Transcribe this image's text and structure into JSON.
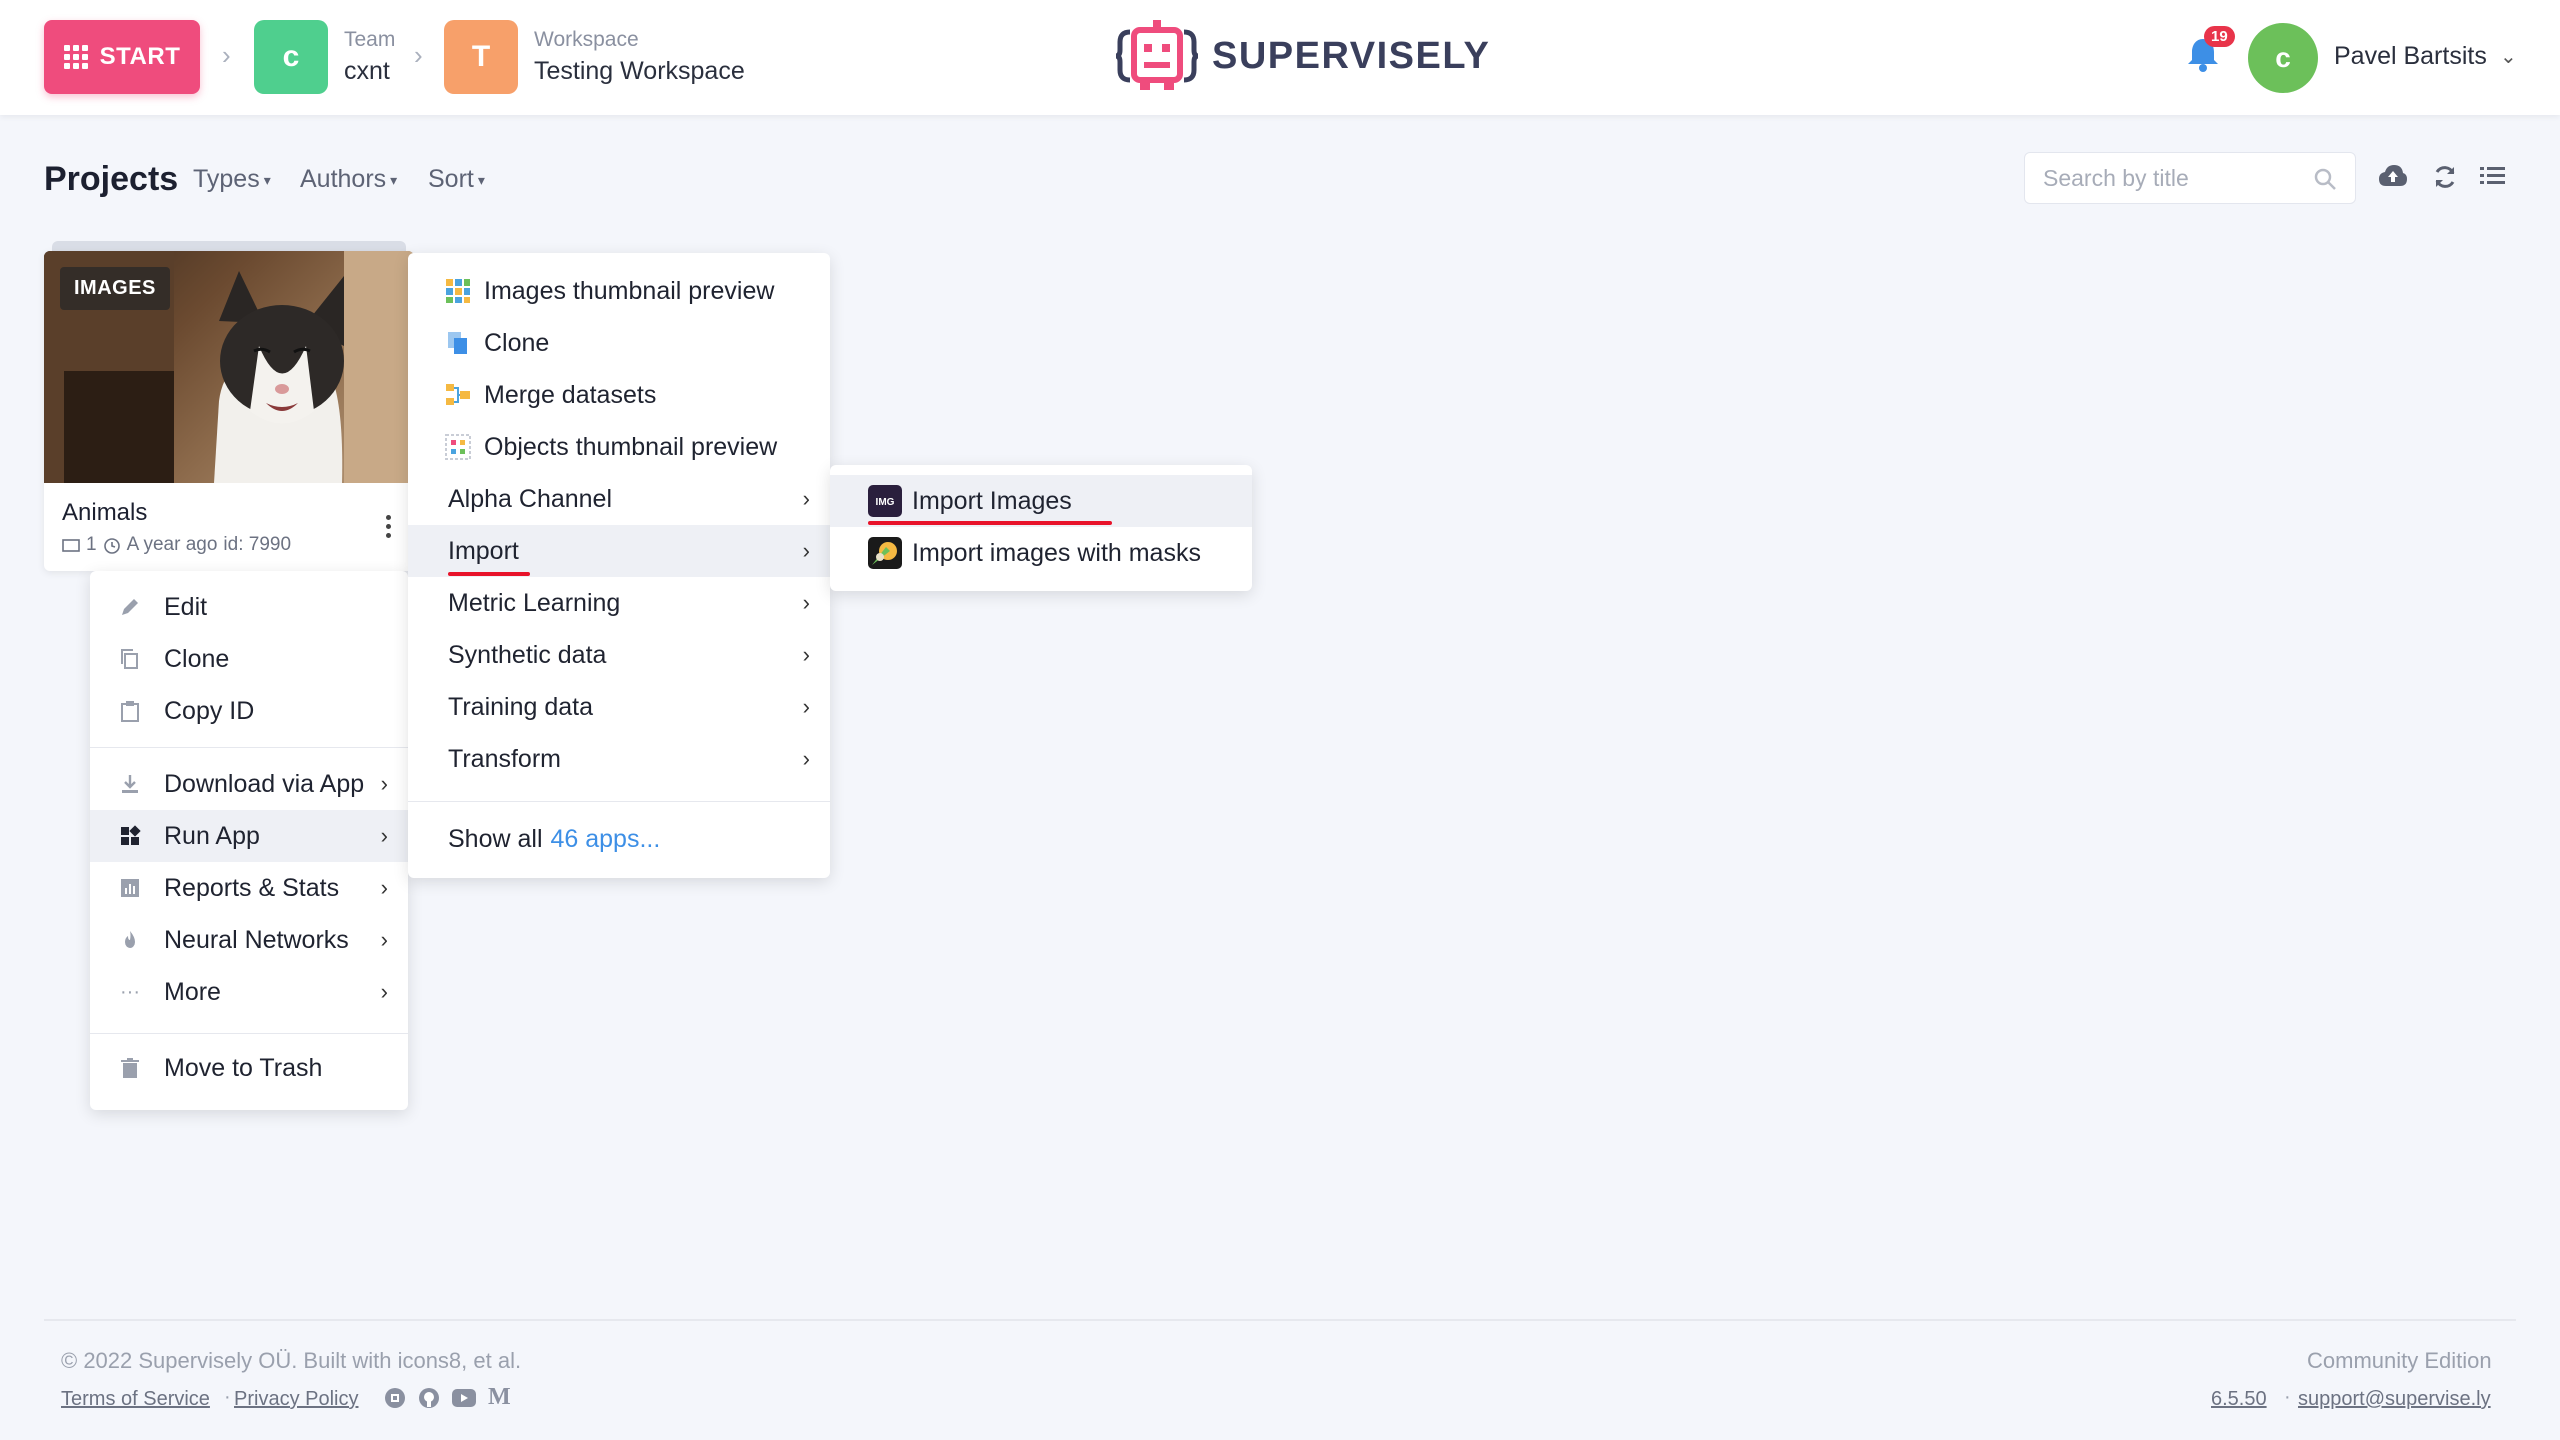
{
  "header": {
    "start_label": "START",
    "team_caption": "Team",
    "team_initial": "c",
    "team_name": "cxnt",
    "team_color": "#4fcf8e",
    "workspace_caption": "Workspace",
    "workspace_initial": "T",
    "workspace_name": "Testing Workspace",
    "workspace_color": "#f7a06a",
    "logo_text": "SUPERVISELY",
    "notification_count": "19",
    "user_initial": "c",
    "user_name": "Pavel Bartsits"
  },
  "toolbar": {
    "title": "Projects",
    "filters": [
      "Types",
      "Authors",
      "Sort"
    ],
    "search_placeholder": "Search by title"
  },
  "project": {
    "type_badge": "IMAGES",
    "name": "Animals",
    "datasets": "1",
    "updated": "A year ago",
    "id": "id: 7990"
  },
  "context_menu": {
    "items_top": [
      "Edit",
      "Clone",
      "Copy ID"
    ],
    "items_mid": [
      "Download via App",
      "Run App",
      "Reports & Stats",
      "Neural Networks",
      "More"
    ],
    "item_bottom": "Move to Trash"
  },
  "apps_menu": {
    "apps": [
      "Images thumbnail preview",
      "Clone",
      "Merge datasets",
      "Objects thumbnail preview"
    ],
    "categories": [
      "Alpha Channel",
      "Import",
      "Metric Learning",
      "Synthetic data",
      "Training data",
      "Transform"
    ],
    "show_all": "Show all",
    "show_all_link": "46 apps..."
  },
  "import_menu": {
    "items": [
      "Import Images",
      "Import images with masks"
    ]
  },
  "footer": {
    "copyright": "© 2022 Supervisely OÜ. Built with icons8, et al.",
    "terms": "Terms of Service",
    "privacy": "Privacy Policy",
    "edition": "Community Edition",
    "version": "6.5.50",
    "support": "support@supervise.ly"
  },
  "colors": {
    "accent": "#ef4c7d",
    "link": "#3d8fe6",
    "highlight": "#e8132a",
    "user_avatar": "#6cc05a"
  }
}
